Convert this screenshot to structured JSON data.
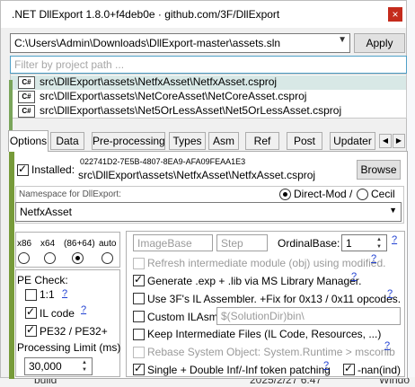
{
  "window": {
    "title": ".NET DllExport 1.8.0+f4deb0e · github.com/3F/DllExport",
    "close_glyph": "×"
  },
  "solution": {
    "path": "C:\\Users\\Admin\\Downloads\\DllExport-master\\assets.sln",
    "apply_label": "Apply"
  },
  "filter": {
    "placeholder": "Filter by project path ..."
  },
  "projects": [
    {
      "icon": "C#",
      "path": "src\\DllExport\\assets\\NetfxAsset\\NetfxAsset.csproj",
      "selected": true
    },
    {
      "icon": "C#",
      "path": "src\\DllExport\\assets\\NetCoreAsset\\NetCoreAsset.csproj",
      "selected": false
    },
    {
      "icon": "C#",
      "path": "src\\DllExport\\assets\\Net5OrLessAsset\\Net5OrLessAsset.csproj",
      "selected": false
    }
  ],
  "tabs": [
    "Options",
    "Data",
    "Pre-processing",
    "Types",
    "Asm",
    "Ref",
    "Post",
    "Updater"
  ],
  "installed": {
    "label": "Installed:",
    "checked": true,
    "guid": "022741D2-7E5B-4807-8EA9-AFA09FEAA1E3",
    "project_path": "src\\DllExport\\assets\\NetfxAsset\\NetfxAsset.csproj",
    "browse_label": "Browse"
  },
  "namespace": {
    "label": "Namespace for DllExport:",
    "value": "NetfxAsset",
    "direct_mod": "Direct-Mod /",
    "cecil": "Cecil"
  },
  "platforms": [
    "x86",
    "x64",
    "(86+64)",
    "auto"
  ],
  "pe_check": {
    "label": "PE Check:",
    "one_to_one": "1:1",
    "il_code": "IL code",
    "pe32": "PE32 / PE32+"
  },
  "processing_limit": {
    "label": "Processing Limit (ms)",
    "value": "30,000"
  },
  "image_base": {
    "placeholder": "ImageBase",
    "step_placeholder": "Step",
    "ordinal_label": "OrdinalBase:",
    "ordinal_value": "1"
  },
  "options": {
    "refresh_obj": "Refresh intermediate module (obj) using modified.",
    "gen_exp_lib": "Generate .exp + .lib via MS Library Manager.",
    "use_ilasm": "Use 3F's IL Assembler. +Fix for 0x13 / 0x11 opcodes.",
    "custom_ilasm": "Custom ILAsm:",
    "custom_ilasm_path": "$(SolutionDir)bin\\",
    "keep_intermediate": "Keep Intermediate Files (IL Code, Resources, ...)",
    "rebase_system": "Rebase System Object: System.Runtime > mscorlib",
    "inf_token": "Single + Double Inf/-Inf token patching",
    "nan": "-nan(ind)"
  },
  "help_mark": "?",
  "background": {
    "build_label": "build",
    "date": "2025/2/27 6:47",
    "windows": "Windo"
  },
  "colors": {
    "accent": "#0078d4",
    "close_red": "#c42b1c",
    "selection": "#d8e8e6",
    "help_link": "#1f3fd1",
    "green_bar": "#779b3a"
  }
}
